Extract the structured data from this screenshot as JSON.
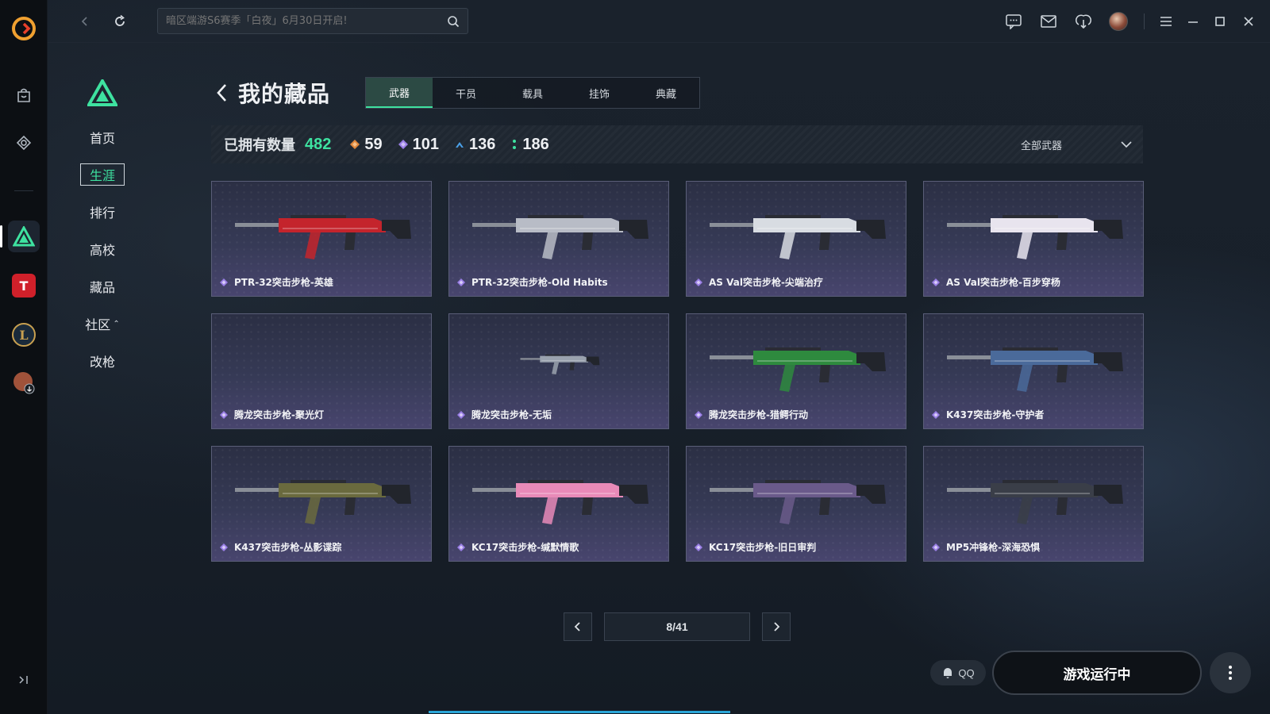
{
  "search": {
    "placeholder": "暗区端游S6赛季「白夜」6月30日开启!"
  },
  "sidebar": {
    "items": [
      {
        "label": "首页"
      },
      {
        "label": "生涯"
      },
      {
        "label": "排行"
      },
      {
        "label": "高校"
      },
      {
        "label": "藏品"
      },
      {
        "label": "社区"
      },
      {
        "label": "改枪"
      }
    ],
    "active": "生涯"
  },
  "header": {
    "title": "我的藏品"
  },
  "tabs": [
    {
      "label": "武器"
    },
    {
      "label": "干员"
    },
    {
      "label": "载具"
    },
    {
      "label": "挂饰"
    },
    {
      "label": "典藏"
    }
  ],
  "stats": {
    "owned_label": "已拥有数量",
    "owned_count": "482",
    "rarities": [
      {
        "count": "59",
        "color": "#e0863a"
      },
      {
        "count": "101",
        "color": "#9a7ee6"
      },
      {
        "count": "136",
        "color": "#4aa0e8"
      },
      {
        "count": "186",
        "color": "#3ee2a0"
      }
    ],
    "filter_label": "全部武器"
  },
  "items": [
    {
      "name": "PTR-32突击步枪-英雄",
      "accent": "#c4242c"
    },
    {
      "name": "PTR-32突击步枪-Old Habits",
      "accent": "#b8bcc6"
    },
    {
      "name": "AS Val突击步枪-尖端治疗",
      "accent": "#d8dce2"
    },
    {
      "name": "AS Val突击步枪-百步穿杨",
      "accent": "#e8e4ee"
    },
    {
      "name": "腾龙突击步枪-聚光灯",
      "accent": ""
    },
    {
      "name": "腾龙突击步枪-无垢",
      "accent": "#9aa2ae"
    },
    {
      "name": "腾龙突击步枪-猎鳄行动",
      "accent": "#2e8a3e"
    },
    {
      "name": "K437突击步枪-守护者",
      "accent": "#4a6a9a"
    },
    {
      "name": "K437突击步枪-丛影谍踪",
      "accent": "#6a6a3e"
    },
    {
      "name": "KC17突击步枪-缄默情歌",
      "accent": "#e88ab8"
    },
    {
      "name": "KC17突击步枪-旧日审判",
      "accent": "#6a5a8a"
    },
    {
      "name": "MP5冲锋枪-深海恐惧",
      "accent": "#3a3e48"
    }
  ],
  "pagination": {
    "label": "8/41"
  },
  "actions": {
    "qq_label": "QQ",
    "launch_label": "游戏运行中"
  },
  "colors": {
    "accent_green": "#3ee2a0",
    "rarity_purple": "#9a7ee6"
  }
}
